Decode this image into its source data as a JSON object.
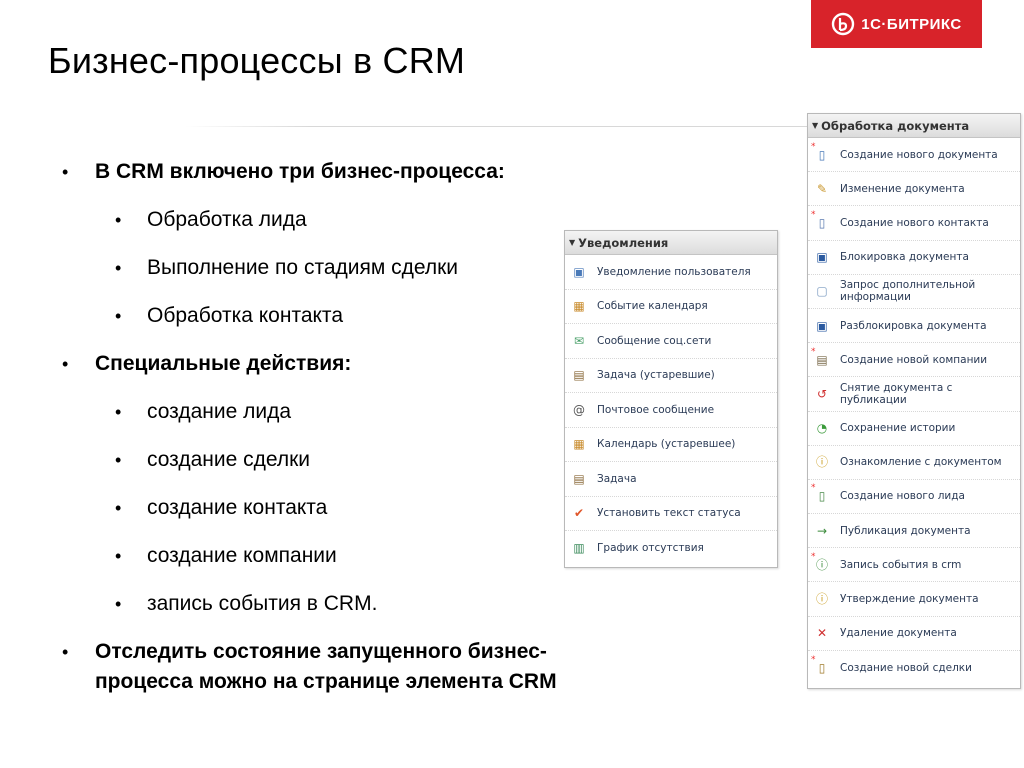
{
  "page_title": "Бизнес-процессы в CRM",
  "logo": {
    "text": "1С·БИТРИКС",
    "color": "#d8232a"
  },
  "bullets": {
    "main1": "В CRM включено три бизнес-процесса:",
    "sub1": [
      "Обработка лида",
      "Выполнение по стадиям сделки",
      "Обработка контакта"
    ],
    "main2": "Специальные действия:",
    "sub2": [
      "создание лида",
      "создание сделки",
      "создание контакта",
      "создание компании",
      "запись события в CRM."
    ],
    "main3_line1": "Отследить состояние запущенного бизнес-",
    "main3_line2": "процесса можно на странице элемента CRM",
    "marker": "•"
  },
  "notifications_panel": {
    "header": "Уведомления",
    "items": [
      {
        "label": "Уведомление пользователя",
        "icon": "user-notification-icon"
      },
      {
        "label": "Событие календаря",
        "icon": "calendar-icon"
      },
      {
        "label": "Сообщение соц.сети",
        "icon": "chat-icon"
      },
      {
        "label": "Задача (устаревшие)",
        "icon": "task-icon"
      },
      {
        "label": "Почтовое сообщение",
        "icon": "mail-icon"
      },
      {
        "label": "Календарь (устаревшее)",
        "icon": "calendar-icon"
      },
      {
        "label": "Задача",
        "icon": "task-icon"
      },
      {
        "label": "Установить текст статуса",
        "icon": "checkmark-icon"
      },
      {
        "label": "График отсутствия",
        "icon": "schedule-icon"
      }
    ]
  },
  "document_panel": {
    "header": "Обработка документа",
    "items": [
      {
        "label": "Создание нового документа",
        "icon": "new-document-icon"
      },
      {
        "label": "Изменение документа",
        "icon": "edit-document-icon"
      },
      {
        "label": "Создание нового контакта",
        "icon": "new-contact-icon"
      },
      {
        "label": "Блокировка документа",
        "icon": "lock-document-icon"
      },
      {
        "label": "Запрос дополнительной",
        "label2": "информации",
        "icon": "request-info-icon"
      },
      {
        "label": "Разблокировка документа",
        "icon": "unlock-document-icon"
      },
      {
        "label": "Создание новой компании",
        "icon": "new-company-icon"
      },
      {
        "label": "Снятие документа с публикации",
        "icon": "unpublish-document-icon"
      },
      {
        "label": "Сохранение истории",
        "icon": "history-icon"
      },
      {
        "label": "Ознакомление с документом",
        "icon": "review-document-icon"
      },
      {
        "label": "Создание нового лида",
        "icon": "new-lead-icon"
      },
      {
        "label": "Публикация документа",
        "icon": "publish-document-icon"
      },
      {
        "label": "Запись события в crm",
        "icon": "crm-event-icon"
      },
      {
        "label": "Утверждение документа",
        "icon": "approve-document-icon"
      },
      {
        "label": "Удаление документа",
        "icon": "delete-document-icon"
      },
      {
        "label": "Создание новой сделки",
        "icon": "new-deal-icon"
      }
    ]
  }
}
